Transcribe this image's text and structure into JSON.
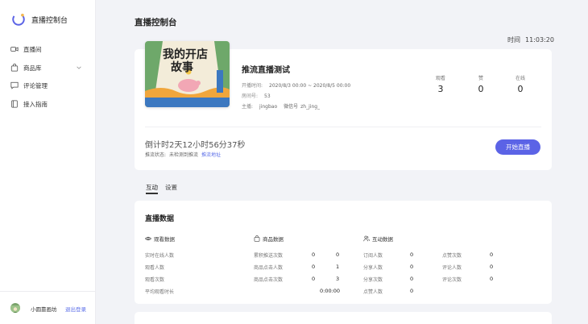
{
  "app": {
    "title": "直播控制台"
  },
  "sidebar": {
    "items": [
      {
        "label": "直播间",
        "icon": "video-camera-icon"
      },
      {
        "label": "商品库",
        "icon": "shopping-bag-icon",
        "has_submenu": true
      },
      {
        "label": "评论管理",
        "icon": "comment-icon"
      },
      {
        "label": "接入指南",
        "icon": "book-icon"
      }
    ],
    "footer": {
      "username": "小圆靠画坊",
      "logout_label": "退出登录"
    }
  },
  "header": {
    "title": "直播控制台",
    "clock_label": "时间",
    "clock_value": "11:03:20"
  },
  "live": {
    "cover_text_line1": "我的开店",
    "cover_text_line2": "故事",
    "title": "推流直播测试",
    "start_time_label": "开播时间:",
    "start_time_value": "2020/8/3 00:00 ~ 2020/8/5 00:00",
    "room_label": "房间号:",
    "room_value": "53",
    "host_label": "主播:",
    "host_value": "jingbao",
    "wechat_label": "微信号",
    "wechat_value": "zh_jing_",
    "stats": [
      {
        "label": "观看",
        "value": "3"
      },
      {
        "label": "赞",
        "value": "0"
      },
      {
        "label": "在线",
        "value": "0"
      }
    ],
    "countdown": "倒计时2天12小时56分37秒",
    "stream_status_label": "推流状态:",
    "stream_status_value": "未检测到推流",
    "stream_url_link": "推流地址",
    "start_button": "开始直播"
  },
  "tabs": [
    {
      "label": "互动",
      "active": true
    },
    {
      "label": "设置",
      "active": false
    }
  ],
  "live_data": {
    "title": "直播数据",
    "groups": [
      {
        "title": "观看数据",
        "icon": "eye-icon",
        "metrics": [
          {
            "label": "实时在线人数",
            "value": "0"
          },
          {
            "label": "观看人数",
            "value": "1"
          },
          {
            "label": "观看次数",
            "value": "3"
          },
          {
            "label": "平均观看时长",
            "value": "0:00:00"
          }
        ]
      },
      {
        "title": "商品数据",
        "icon": "shopping-bag-icon",
        "metrics": [
          {
            "label": "累积推送次数",
            "value": "0"
          },
          {
            "label": "商品点击人数",
            "value": "0"
          },
          {
            "label": "商品点击次数",
            "value": "0"
          }
        ]
      },
      {
        "title": "互动数据",
        "icon": "users-icon",
        "metrics": [
          {
            "label": "订阅人数",
            "value": "0"
          },
          {
            "label": "分享人数",
            "value": "0"
          },
          {
            "label": "分享次数",
            "value": "0"
          },
          {
            "label": "点赞人数",
            "value": "0"
          },
          {
            "label": "点赞次数",
            "value": "0"
          },
          {
            "label": "评论人数",
            "value": "0"
          },
          {
            "label": "评论次数",
            "value": "0"
          }
        ]
      }
    ]
  },
  "colors": {
    "accent": "#5b63e6",
    "link": "#5b6ee8",
    "background": "#f2f3f7"
  }
}
